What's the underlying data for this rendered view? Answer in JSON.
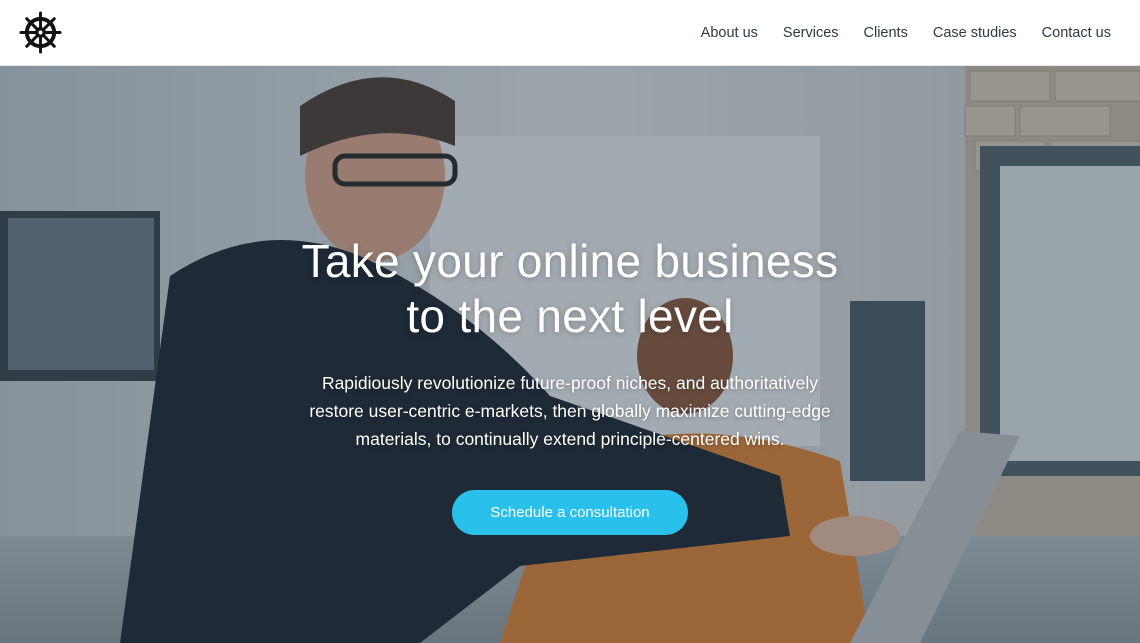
{
  "header": {
    "logo_icon": "ship-wheel-icon",
    "nav": [
      {
        "label": "About us"
      },
      {
        "label": "Services"
      },
      {
        "label": "Clients"
      },
      {
        "label": "Case studies"
      },
      {
        "label": "Contact us"
      }
    ]
  },
  "hero": {
    "title_line1": "Take your online business",
    "title_line2": "to the next level",
    "subtitle_line1": "Rapidiously revolutionize future-proof niches, and authoritatively",
    "subtitle_line2": "restore user-centric e-markets, then globally maximize cutting-edge",
    "subtitle_line3": "materials, to continually extend principle-centered wins.",
    "cta_label": "Schedule a consultation",
    "background": "office-meeting-photo"
  },
  "colors": {
    "accent": "#29c1ec",
    "header_bg": "#ffffff",
    "nav_text": "#2d3a46"
  }
}
